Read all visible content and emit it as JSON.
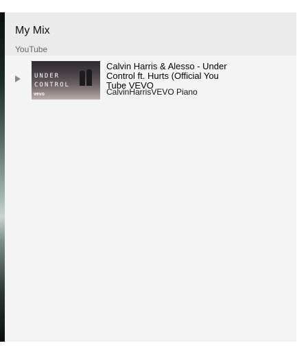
{
  "mix": {
    "title": "My Mix",
    "source": "YouTube"
  },
  "playlist": {
    "items": [
      {
        "title_line_1": "Calvin Harris & Alesso - Under",
        "title_line_2": "Control ft. Hurts (Official You",
        "title_line_3": "Tube VEVO",
        "channel": "CalvinHarrisVEVO Piano",
        "thumbnail_text_1": "UNDER",
        "thumbnail_text_2": "CONTROL",
        "thumbnail_brand": "vevo",
        "now_playing_icon": "play-indicator-icon"
      }
    ]
  }
}
